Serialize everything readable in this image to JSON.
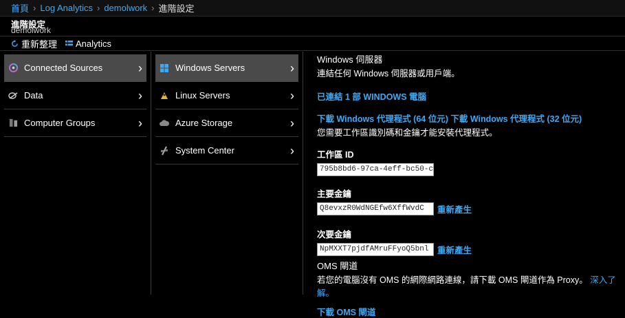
{
  "breadcrumb": {
    "home": "首頁",
    "log_analytics": "Log Analytics",
    "workspace": "demolwork",
    "current": "進階設定",
    "separator": "›"
  },
  "blade": {
    "title": "進階設定",
    "subtitle": "demolwork"
  },
  "commands": {
    "refresh": "重新整理",
    "analytics": "Analytics"
  },
  "sources_nav": [
    {
      "label": "Connected Sources",
      "icon": "connected-sources-icon",
      "selected": true
    },
    {
      "label": "Data",
      "icon": "data-icon",
      "selected": false
    },
    {
      "label": "Computer Groups",
      "icon": "computer-groups-icon",
      "selected": false
    }
  ],
  "connected_nav": [
    {
      "label": "Windows Servers",
      "icon": "windows-icon",
      "selected": true
    },
    {
      "label": "Linux Servers",
      "icon": "linux-icon",
      "selected": false
    },
    {
      "label": "Azure Storage",
      "icon": "cloud-icon",
      "selected": false
    },
    {
      "label": "System Center",
      "icon": "system-center-icon",
      "selected": false
    }
  ],
  "detail": {
    "heading": "Windows 伺服器",
    "desc": "連結任何 Windows 伺服器或用戶端。",
    "connected_link": "已連結 1 部 WINDOWS 電腦",
    "download_64": "下載 Windows 代理程式 (64 位元)",
    "download_32": "下載 Windows 代理程式 (32 位元)",
    "install_note": "您需要工作區識別碼和金鑰才能安裝代理程式。",
    "workspace_id_label": "工作區 ID",
    "workspace_id_value": "795b8bd6-97ca-4eff-bc50-c",
    "primary_key_label": "主要金鑰",
    "primary_key_value": "Q8evxzR0WdNGEfw6XffWvdC",
    "secondary_key_label": "次要金鑰",
    "secondary_key_value": "NpMXXT7pjdfAMruFFyoQ5bnl",
    "regenerate": "重新產生",
    "oms_heading": "OMS 閘道",
    "oms_desc": "若您的電腦沒有 OMS 的網際網路連線，請下載 OMS 閘道作為 Proxy。",
    "learn_more": "深入了解。",
    "oms_download": "下載 OMS 閘道"
  },
  "colors": {
    "background": "#000000",
    "link": "#3fa9f5",
    "selected_row": "#4a4a4a"
  }
}
